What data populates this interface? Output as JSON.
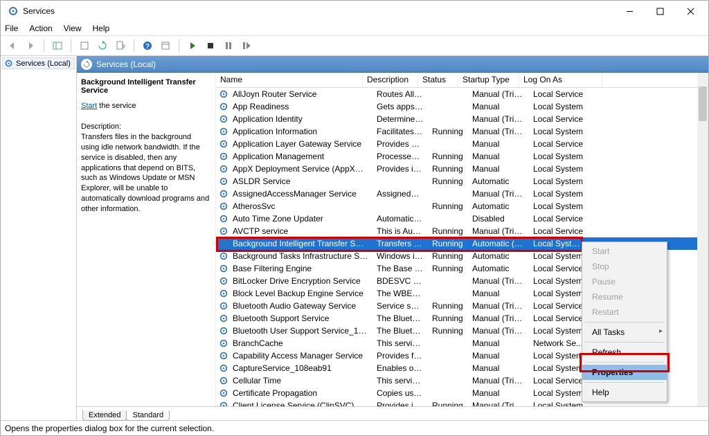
{
  "window": {
    "title": "Services"
  },
  "menu": {
    "file": "File",
    "action": "Action",
    "view": "View",
    "help": "Help"
  },
  "tree": {
    "root": "Services (Local)"
  },
  "detail_header": "Services (Local)",
  "info": {
    "selected_name": "Background Intelligent Transfer Service",
    "start_link": "Start",
    "start_suffix": " the service",
    "desc_label": "Description:",
    "desc_text": "Transfers files in the background using idle network bandwidth. If the service is disabled, then any applications that depend on BITS, such as Windows Update or MSN Explorer, will be unable to automatically download programs and other information."
  },
  "columns": {
    "name": "Name",
    "description": "Description",
    "status": "Status",
    "startup": "Startup Type",
    "logon": "Log On As"
  },
  "rows": [
    {
      "name": "AllJoyn Router Service",
      "desc": "Routes AllJo...",
      "status": "",
      "startup": "Manual (Trigg...",
      "logon": "Local Service"
    },
    {
      "name": "App Readiness",
      "desc": "Gets apps re...",
      "status": "",
      "startup": "Manual",
      "logon": "Local System"
    },
    {
      "name": "Application Identity",
      "desc": "Determines ...",
      "status": "",
      "startup": "Manual (Trigg...",
      "logon": "Local Service"
    },
    {
      "name": "Application Information",
      "desc": "Facilitates th...",
      "status": "Running",
      "startup": "Manual (Trigg...",
      "logon": "Local System"
    },
    {
      "name": "Application Layer Gateway Service",
      "desc": "Provides sup...",
      "status": "",
      "startup": "Manual",
      "logon": "Local Service"
    },
    {
      "name": "Application Management",
      "desc": "Processes in...",
      "status": "Running",
      "startup": "Manual",
      "logon": "Local System"
    },
    {
      "name": "AppX Deployment Service (AppXSVC)",
      "desc": "Provides infr...",
      "status": "Running",
      "startup": "Manual",
      "logon": "Local System"
    },
    {
      "name": "ASLDR Service",
      "desc": "",
      "status": "Running",
      "startup": "Automatic",
      "logon": "Local System"
    },
    {
      "name": "AssignedAccessManager Service",
      "desc": "AssignedAcc...",
      "status": "",
      "startup": "Manual (Trigg...",
      "logon": "Local System"
    },
    {
      "name": "AtherosSvc",
      "desc": "",
      "status": "Running",
      "startup": "Automatic",
      "logon": "Local System"
    },
    {
      "name": "Auto Time Zone Updater",
      "desc": "Automaticall...",
      "status": "",
      "startup": "Disabled",
      "logon": "Local Service"
    },
    {
      "name": "AVCTP service",
      "desc": "This is Audio...",
      "status": "Running",
      "startup": "Manual (Trigg...",
      "logon": "Local Service"
    },
    {
      "name": "Background Intelligent Transfer Service",
      "desc": "Transfers file...",
      "status": "Running",
      "startup": "Automatic (De...",
      "logon": "Local System",
      "selected": true
    },
    {
      "name": "Background Tasks Infrastructure Servi...",
      "desc": "Windows inf...",
      "status": "Running",
      "startup": "Automatic",
      "logon": "Local System"
    },
    {
      "name": "Base Filtering Engine",
      "desc": "The Base Filt...",
      "status": "Running",
      "startup": "Automatic",
      "logon": "Local Service"
    },
    {
      "name": "BitLocker Drive Encryption Service",
      "desc": "BDESVC hos...",
      "status": "",
      "startup": "Manual (Trigg...",
      "logon": "Local System"
    },
    {
      "name": "Block Level Backup Engine Service",
      "desc": "The WBENGI...",
      "status": "",
      "startup": "Manual",
      "logon": "Local System"
    },
    {
      "name": "Bluetooth Audio Gateway Service",
      "desc": "Service supp...",
      "status": "Running",
      "startup": "Manual (Trigg...",
      "logon": "Local Service"
    },
    {
      "name": "Bluetooth Support Service",
      "desc": "The Bluetoo...",
      "status": "Running",
      "startup": "Manual (Trigg...",
      "logon": "Local Service"
    },
    {
      "name": "Bluetooth User Support Service_108e...",
      "desc": "The Bluetoo...",
      "status": "Running",
      "startup": "Manual (Trigg...",
      "logon": "Local System"
    },
    {
      "name": "BranchCache",
      "desc": "This service ...",
      "status": "",
      "startup": "Manual",
      "logon": "Network Se..."
    },
    {
      "name": "Capability Access Manager Service",
      "desc": "Provides faci...",
      "status": "",
      "startup": "Manual",
      "logon": "Local System"
    },
    {
      "name": "CaptureService_108eab91",
      "desc": "Enables opti...",
      "status": "",
      "startup": "Manual",
      "logon": "Local System"
    },
    {
      "name": "Cellular Time",
      "desc": "This service ...",
      "status": "",
      "startup": "Manual (Trigg...",
      "logon": "Local Service"
    },
    {
      "name": "Certificate Propagation",
      "desc": "Copies user ...",
      "status": "",
      "startup": "Manual",
      "logon": "Local System"
    },
    {
      "name": "Client License Service (ClipSVC)",
      "desc": "Provides infr...",
      "status": "Running",
      "startup": "Manual (Trigg...",
      "logon": "Local System"
    }
  ],
  "tabs": {
    "extended": "Extended",
    "standard": "Standard"
  },
  "statusbar": "Opens the properties dialog box for the current selection.",
  "context_menu": {
    "start": "Start",
    "stop": "Stop",
    "pause": "Pause",
    "resume": "Resume",
    "restart": "Restart",
    "all_tasks": "All Tasks",
    "refresh": "Refresh",
    "properties": "Properties",
    "help": "Help"
  }
}
